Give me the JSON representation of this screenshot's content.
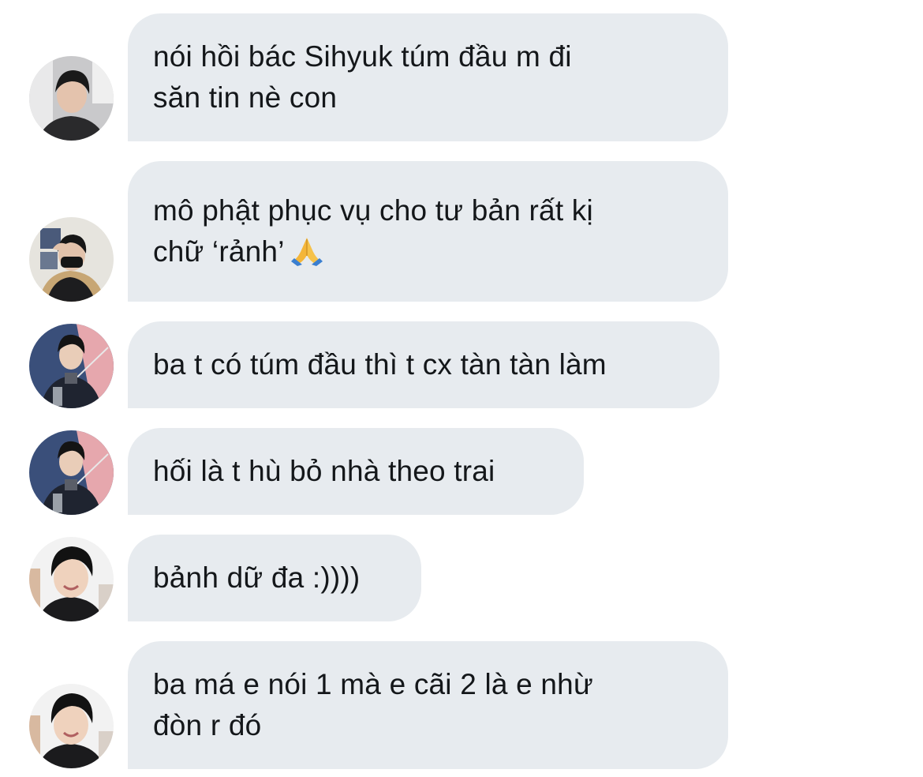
{
  "messages": [
    {
      "text": "nói hồi bác Sihyuk túm đầu m đi\nsăn tin nè con",
      "avatar": "avatar-dark-hair-man"
    },
    {
      "text": "mô phật phục vụ cho tư bản rất kị\nchữ ‘rảnh’",
      "emoji": "folded-hands-icon",
      "avatar": "avatar-masked-man"
    },
    {
      "text": "ba t có túm đầu thì t cx tàn tàn làm",
      "avatar": "avatar-trophy-man"
    },
    {
      "text": "hối là t hù bỏ nhà theo trai",
      "avatar": "avatar-trophy-man"
    },
    {
      "text": "bảnh dữ đa :))))",
      "avatar": "avatar-smiling-man"
    },
    {
      "text": "ba má e nói 1 mà e cãi 2 là e nhừ\nđòn r đó",
      "avatar": "avatar-smiling-man"
    }
  ],
  "colors": {
    "bubble": "#e7ebef",
    "text": "#14171a",
    "background": "#ffffff"
  }
}
